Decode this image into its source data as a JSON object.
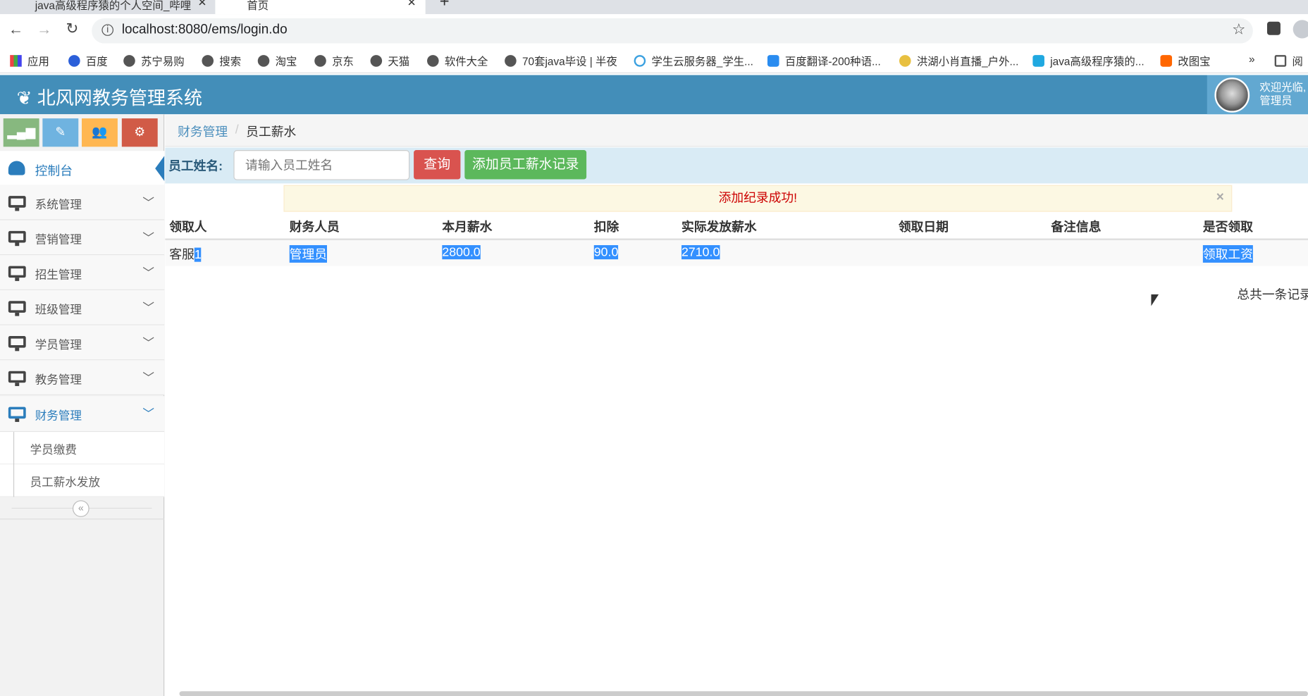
{
  "browser": {
    "tabs": [
      {
        "title": "java高级程序猿的个人空间_哔哩",
        "active": false
      },
      {
        "title": "首页",
        "active": true
      }
    ],
    "new_tab": "+",
    "url": "localhost:8080/ems/login.do",
    "bookmarks": [
      "应用",
      "百度",
      "苏宁易购",
      "搜索",
      "淘宝",
      "京东",
      "天猫",
      "软件大全",
      "70套java毕设 | 半夜",
      "学生云服务器_学生...",
      "百度翻译-200种语...",
      "洪湖小肖直播_户外...",
      "java高级程序猿的...",
      "改图宝"
    ],
    "more": "»",
    "reading_list": "阅"
  },
  "header": {
    "title": "北风网教务管理系统",
    "welcome": "欢迎光临,",
    "user": "管理员"
  },
  "shortcuts": [
    {
      "icon": "signal-icon",
      "color": "#87b87f"
    },
    {
      "icon": "pencil-icon",
      "color": "#6fb3e0"
    },
    {
      "icon": "users-icon",
      "color": "#ffb752"
    },
    {
      "icon": "cogs-icon",
      "color": "#d15b47"
    }
  ],
  "sidebar": {
    "dashboard": "控制台",
    "items": [
      "系统管理",
      "营销管理",
      "招生管理",
      "班级管理",
      "学员管理",
      "教务管理",
      "财务管理"
    ],
    "submenu": [
      "学员缴费",
      "员工薪水发放"
    ]
  },
  "breadcrumb": {
    "parent": "财务管理",
    "sep": "/",
    "current": "员工薪水"
  },
  "search": {
    "label": "员工姓名:",
    "placeholder": "请输入员工姓名",
    "query": "查询",
    "add": "添加员工薪水记录"
  },
  "alert": {
    "message": "添加纪录成功!",
    "close": "×"
  },
  "table": {
    "headers": [
      "领取人",
      "财务人员",
      "本月薪水",
      "扣除",
      "实际发放薪水",
      "领取日期",
      "备注信息",
      "是否领取"
    ],
    "rows": [
      {
        "receiver_a": "客服",
        "receiver_b": "1",
        "finance": "管理员",
        "salary": "2800.0",
        "deduct": "90.0",
        "actual": "2710.0",
        "date": "",
        "note": "",
        "action": "领取工资"
      }
    ]
  },
  "footer": {
    "total": "总共一条记录"
  }
}
